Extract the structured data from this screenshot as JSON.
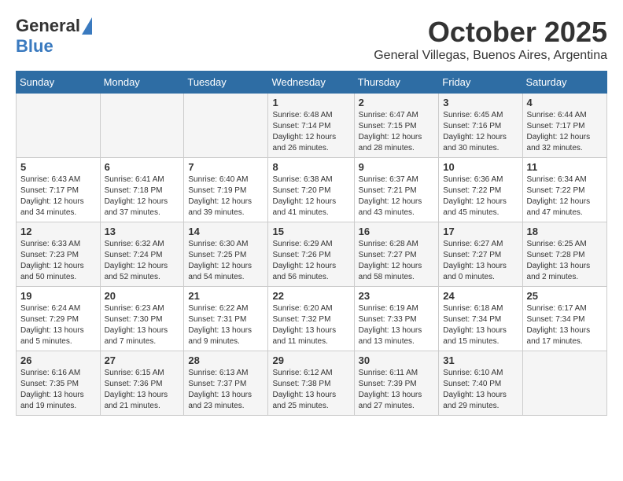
{
  "header": {
    "logo_general": "General",
    "logo_blue": "Blue",
    "month_title": "October 2025",
    "subtitle": "General Villegas, Buenos Aires, Argentina"
  },
  "days_of_week": [
    "Sunday",
    "Monday",
    "Tuesday",
    "Wednesday",
    "Thursday",
    "Friday",
    "Saturday"
  ],
  "weeks": [
    [
      {
        "day": "",
        "info": ""
      },
      {
        "day": "",
        "info": ""
      },
      {
        "day": "",
        "info": ""
      },
      {
        "day": "1",
        "info": "Sunrise: 6:48 AM\nSunset: 7:14 PM\nDaylight: 12 hours\nand 26 minutes."
      },
      {
        "day": "2",
        "info": "Sunrise: 6:47 AM\nSunset: 7:15 PM\nDaylight: 12 hours\nand 28 minutes."
      },
      {
        "day": "3",
        "info": "Sunrise: 6:45 AM\nSunset: 7:16 PM\nDaylight: 12 hours\nand 30 minutes."
      },
      {
        "day": "4",
        "info": "Sunrise: 6:44 AM\nSunset: 7:17 PM\nDaylight: 12 hours\nand 32 minutes."
      }
    ],
    [
      {
        "day": "5",
        "info": "Sunrise: 6:43 AM\nSunset: 7:17 PM\nDaylight: 12 hours\nand 34 minutes."
      },
      {
        "day": "6",
        "info": "Sunrise: 6:41 AM\nSunset: 7:18 PM\nDaylight: 12 hours\nand 37 minutes."
      },
      {
        "day": "7",
        "info": "Sunrise: 6:40 AM\nSunset: 7:19 PM\nDaylight: 12 hours\nand 39 minutes."
      },
      {
        "day": "8",
        "info": "Sunrise: 6:38 AM\nSunset: 7:20 PM\nDaylight: 12 hours\nand 41 minutes."
      },
      {
        "day": "9",
        "info": "Sunrise: 6:37 AM\nSunset: 7:21 PM\nDaylight: 12 hours\nand 43 minutes."
      },
      {
        "day": "10",
        "info": "Sunrise: 6:36 AM\nSunset: 7:22 PM\nDaylight: 12 hours\nand 45 minutes."
      },
      {
        "day": "11",
        "info": "Sunrise: 6:34 AM\nSunset: 7:22 PM\nDaylight: 12 hours\nand 47 minutes."
      }
    ],
    [
      {
        "day": "12",
        "info": "Sunrise: 6:33 AM\nSunset: 7:23 PM\nDaylight: 12 hours\nand 50 minutes."
      },
      {
        "day": "13",
        "info": "Sunrise: 6:32 AM\nSunset: 7:24 PM\nDaylight: 12 hours\nand 52 minutes."
      },
      {
        "day": "14",
        "info": "Sunrise: 6:30 AM\nSunset: 7:25 PM\nDaylight: 12 hours\nand 54 minutes."
      },
      {
        "day": "15",
        "info": "Sunrise: 6:29 AM\nSunset: 7:26 PM\nDaylight: 12 hours\nand 56 minutes."
      },
      {
        "day": "16",
        "info": "Sunrise: 6:28 AM\nSunset: 7:27 PM\nDaylight: 12 hours\nand 58 minutes."
      },
      {
        "day": "17",
        "info": "Sunrise: 6:27 AM\nSunset: 7:27 PM\nDaylight: 13 hours\nand 0 minutes."
      },
      {
        "day": "18",
        "info": "Sunrise: 6:25 AM\nSunset: 7:28 PM\nDaylight: 13 hours\nand 2 minutes."
      }
    ],
    [
      {
        "day": "19",
        "info": "Sunrise: 6:24 AM\nSunset: 7:29 PM\nDaylight: 13 hours\nand 5 minutes."
      },
      {
        "day": "20",
        "info": "Sunrise: 6:23 AM\nSunset: 7:30 PM\nDaylight: 13 hours\nand 7 minutes."
      },
      {
        "day": "21",
        "info": "Sunrise: 6:22 AM\nSunset: 7:31 PM\nDaylight: 13 hours\nand 9 minutes."
      },
      {
        "day": "22",
        "info": "Sunrise: 6:20 AM\nSunset: 7:32 PM\nDaylight: 13 hours\nand 11 minutes."
      },
      {
        "day": "23",
        "info": "Sunrise: 6:19 AM\nSunset: 7:33 PM\nDaylight: 13 hours\nand 13 minutes."
      },
      {
        "day": "24",
        "info": "Sunrise: 6:18 AM\nSunset: 7:34 PM\nDaylight: 13 hours\nand 15 minutes."
      },
      {
        "day": "25",
        "info": "Sunrise: 6:17 AM\nSunset: 7:34 PM\nDaylight: 13 hours\nand 17 minutes."
      }
    ],
    [
      {
        "day": "26",
        "info": "Sunrise: 6:16 AM\nSunset: 7:35 PM\nDaylight: 13 hours\nand 19 minutes."
      },
      {
        "day": "27",
        "info": "Sunrise: 6:15 AM\nSunset: 7:36 PM\nDaylight: 13 hours\nand 21 minutes."
      },
      {
        "day": "28",
        "info": "Sunrise: 6:13 AM\nSunset: 7:37 PM\nDaylight: 13 hours\nand 23 minutes."
      },
      {
        "day": "29",
        "info": "Sunrise: 6:12 AM\nSunset: 7:38 PM\nDaylight: 13 hours\nand 25 minutes."
      },
      {
        "day": "30",
        "info": "Sunrise: 6:11 AM\nSunset: 7:39 PM\nDaylight: 13 hours\nand 27 minutes."
      },
      {
        "day": "31",
        "info": "Sunrise: 6:10 AM\nSunset: 7:40 PM\nDaylight: 13 hours\nand 29 minutes."
      },
      {
        "day": "",
        "info": ""
      }
    ]
  ]
}
